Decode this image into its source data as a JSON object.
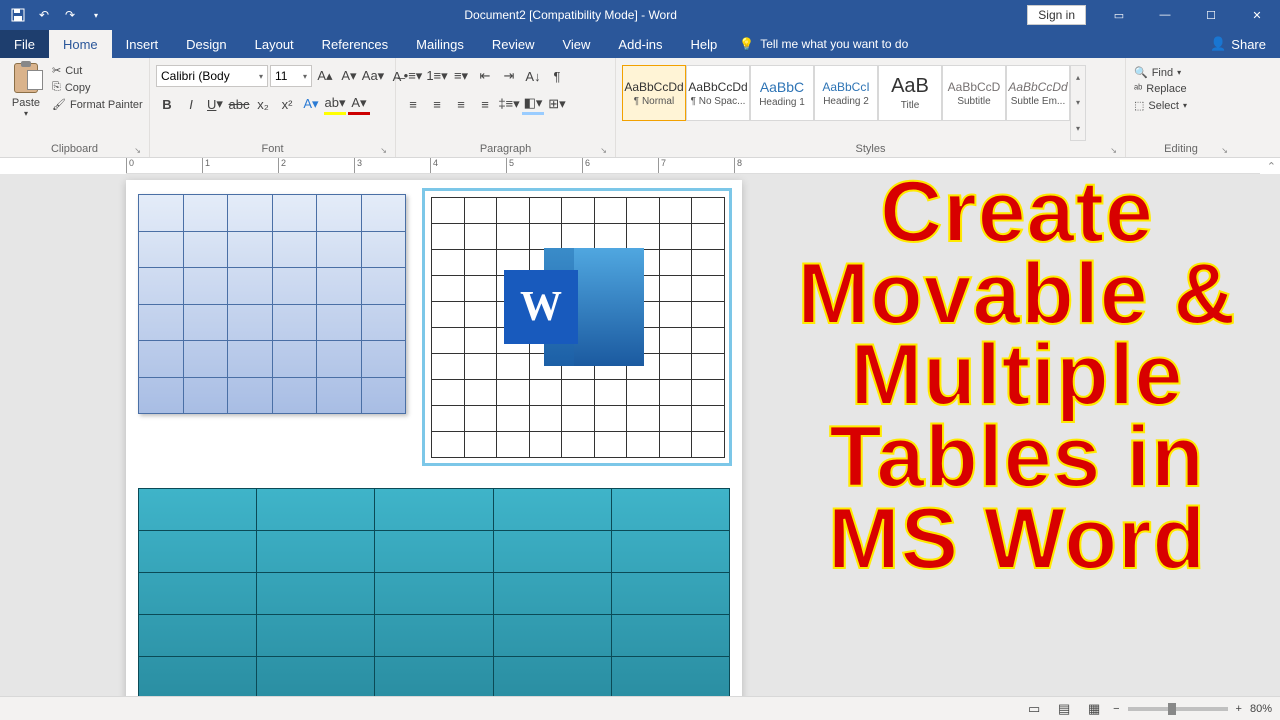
{
  "titlebar": {
    "title": "Document2 [Compatibility Mode] - Word",
    "signin": "Sign in"
  },
  "tabs": {
    "file": "File",
    "home": "Home",
    "insert": "Insert",
    "design": "Design",
    "layout": "Layout",
    "references": "References",
    "mailings": "Mailings",
    "review": "Review",
    "view": "View",
    "addins": "Add-ins",
    "help": "Help",
    "tellme": "Tell me what you want to do",
    "share": "Share"
  },
  "clipboard": {
    "paste": "Paste",
    "cut": "Cut",
    "copy": "Copy",
    "formatpainter": "Format Painter",
    "label": "Clipboard"
  },
  "font": {
    "name": "Calibri (Body",
    "size": "11",
    "label": "Font"
  },
  "paragraph": {
    "label": "Paragraph"
  },
  "styles": {
    "items": [
      {
        "preview": "AaBbCcDd",
        "name": "¶ Normal"
      },
      {
        "preview": "AaBbCcDd",
        "name": "¶ No Spac..."
      },
      {
        "preview": "AaBbC",
        "name": "Heading 1"
      },
      {
        "preview": "AaBbCcI",
        "name": "Heading 2"
      },
      {
        "preview": "AaB",
        "name": "Title"
      },
      {
        "preview": "AaBbCcD",
        "name": "Subtitle"
      },
      {
        "preview": "AaBbCcDd",
        "name": "Subtle Em..."
      }
    ],
    "label": "Styles"
  },
  "editing": {
    "find": "Find",
    "replace": "Replace",
    "select": "Select",
    "label": "Editing"
  },
  "overlay": {
    "line1": "Create",
    "line2": "Movable &",
    "line3": "Multiple",
    "line4": "Tables in",
    "line5": "MS Word"
  },
  "status": {
    "zoom": "80%"
  }
}
